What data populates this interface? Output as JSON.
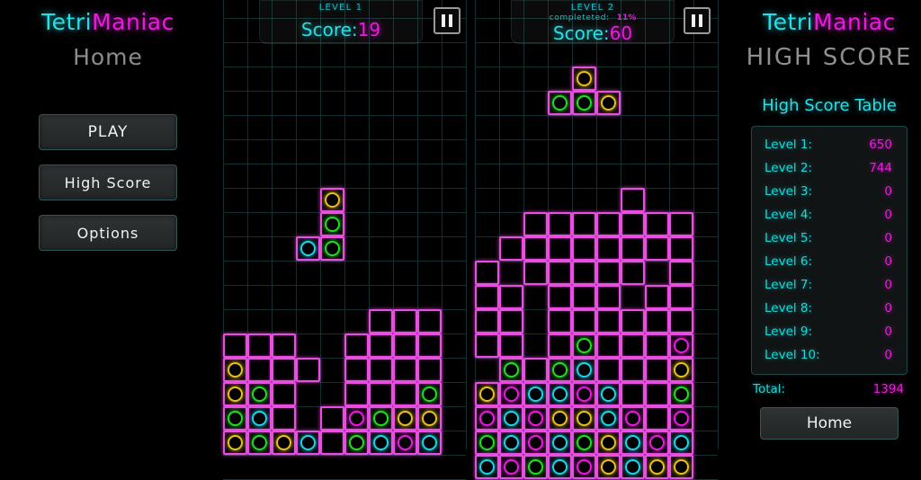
{
  "app": {
    "name_part1": "Tetri",
    "name_part2": "Maniac",
    "accent_cyan": "#24e0e8",
    "accent_magenta": "#ee19e0"
  },
  "left_panel": {
    "subtitle": "Home",
    "buttons": [
      {
        "label": "PLAY",
        "name": "play-button"
      },
      {
        "label": "High Score",
        "name": "high-score-button"
      },
      {
        "label": "Options",
        "name": "options-button"
      }
    ]
  },
  "right_panel": {
    "subtitle": "HIGH SCORE",
    "table_title": "High Score Table",
    "rows": [
      {
        "label": "Level 1:",
        "value": "650"
      },
      {
        "label": "Level 2:",
        "value": "744"
      },
      {
        "label": "Level 3:",
        "value": "0"
      },
      {
        "label": "Level 4:",
        "value": "0"
      },
      {
        "label": "Level 5:",
        "value": "0"
      },
      {
        "label": "Level 6:",
        "value": "0"
      },
      {
        "label": "Level 7:",
        "value": "0"
      },
      {
        "label": "Level 8:",
        "value": "0"
      },
      {
        "label": "Level 9:",
        "value": "0"
      },
      {
        "label": "Level 10:",
        "value": "0"
      }
    ],
    "total_label": "Total:",
    "total_value": "1394",
    "home_label": "Home"
  },
  "boards": [
    {
      "name": "board-left",
      "level_text": "LEVEL 1",
      "completed_label": null,
      "completed_pct": null,
      "score_label": "Score:",
      "score_value": "19",
      "pause_icon": "pause-icon",
      "cols": 10,
      "rows": 19,
      "falling_piece": [
        {
          "r": 8,
          "c": 4,
          "color": "y"
        },
        {
          "r": 9,
          "c": 4,
          "color": "g"
        },
        {
          "r": 10,
          "c": 3,
          "color": "c"
        },
        {
          "r": 10,
          "c": 4,
          "color": "g"
        }
      ],
      "stack": [
        {
          "r": 13,
          "c": 6,
          "color": null
        },
        {
          "r": 13,
          "c": 7,
          "color": null
        },
        {
          "r": 13,
          "c": 8,
          "color": null
        },
        {
          "r": 14,
          "c": 0,
          "color": null
        },
        {
          "r": 14,
          "c": 1,
          "color": null
        },
        {
          "r": 14,
          "c": 2,
          "color": null
        },
        {
          "r": 14,
          "c": 5,
          "color": null
        },
        {
          "r": 14,
          "c": 6,
          "color": null
        },
        {
          "r": 14,
          "c": 7,
          "color": null
        },
        {
          "r": 14,
          "c": 8,
          "color": null
        },
        {
          "r": 15,
          "c": 0,
          "color": "y"
        },
        {
          "r": 15,
          "c": 1,
          "color": null
        },
        {
          "r": 15,
          "c": 2,
          "color": null
        },
        {
          "r": 15,
          "c": 3,
          "color": null
        },
        {
          "r": 15,
          "c": 5,
          "color": null
        },
        {
          "r": 15,
          "c": 6,
          "color": null
        },
        {
          "r": 15,
          "c": 7,
          "color": null
        },
        {
          "r": 15,
          "c": 8,
          "color": null
        },
        {
          "r": 16,
          "c": 0,
          "color": "y"
        },
        {
          "r": 16,
          "c": 1,
          "color": "g"
        },
        {
          "r": 16,
          "c": 2,
          "color": null
        },
        {
          "r": 16,
          "c": 5,
          "color": null
        },
        {
          "r": 16,
          "c": 6,
          "color": null
        },
        {
          "r": 16,
          "c": 7,
          "color": null
        },
        {
          "r": 16,
          "c": 8,
          "color": "g"
        },
        {
          "r": 17,
          "c": 0,
          "color": "g"
        },
        {
          "r": 17,
          "c": 1,
          "color": "c"
        },
        {
          "r": 17,
          "c": 2,
          "color": null
        },
        {
          "r": 17,
          "c": 4,
          "color": null
        },
        {
          "r": 17,
          "c": 5,
          "color": "m"
        },
        {
          "r": 17,
          "c": 6,
          "color": "g"
        },
        {
          "r": 17,
          "c": 7,
          "color": "y"
        },
        {
          "r": 17,
          "c": 8,
          "color": "y"
        },
        {
          "r": 18,
          "c": 0,
          "color": "y"
        },
        {
          "r": 18,
          "c": 1,
          "color": "g"
        },
        {
          "r": 18,
          "c": 2,
          "color": "y"
        },
        {
          "r": 18,
          "c": 3,
          "color": "c"
        },
        {
          "r": 18,
          "c": 4,
          "color": null
        },
        {
          "r": 18,
          "c": 5,
          "color": "g"
        },
        {
          "r": 18,
          "c": 6,
          "color": "c"
        },
        {
          "r": 18,
          "c": 7,
          "color": "m"
        },
        {
          "r": 18,
          "c": 8,
          "color": "c"
        }
      ]
    },
    {
      "name": "board-right",
      "level_text": "LEVEL 2",
      "completed_label": "completeted:",
      "completed_pct": "11%",
      "score_label": "Score:",
      "score_value": "60",
      "pause_icon": "pause-icon",
      "cols": 10,
      "rows": 19,
      "falling_piece": [
        {
          "r": 3,
          "c": 4,
          "color": "y"
        },
        {
          "r": 4,
          "c": 3,
          "color": "g"
        },
        {
          "r": 4,
          "c": 4,
          "color": "g"
        },
        {
          "r": 4,
          "c": 5,
          "color": "y"
        }
      ],
      "stack": [
        {
          "r": 8,
          "c": 6,
          "color": null
        },
        {
          "r": 9,
          "c": 2,
          "color": null
        },
        {
          "r": 9,
          "c": 3,
          "color": null
        },
        {
          "r": 9,
          "c": 4,
          "color": null
        },
        {
          "r": 9,
          "c": 5,
          "color": null
        },
        {
          "r": 9,
          "c": 6,
          "color": null
        },
        {
          "r": 9,
          "c": 7,
          "color": null
        },
        {
          "r": 9,
          "c": 8,
          "color": null
        },
        {
          "r": 10,
          "c": 1,
          "color": null
        },
        {
          "r": 10,
          "c": 2,
          "color": null
        },
        {
          "r": 10,
          "c": 3,
          "color": null
        },
        {
          "r": 10,
          "c": 4,
          "color": null
        },
        {
          "r": 10,
          "c": 5,
          "color": null
        },
        {
          "r": 10,
          "c": 6,
          "color": null
        },
        {
          "r": 10,
          "c": 7,
          "color": null
        },
        {
          "r": 10,
          "c": 8,
          "color": null
        },
        {
          "r": 11,
          "c": 0,
          "color": null
        },
        {
          "r": 11,
          "c": 2,
          "color": null
        },
        {
          "r": 11,
          "c": 3,
          "color": null
        },
        {
          "r": 11,
          "c": 4,
          "color": null
        },
        {
          "r": 11,
          "c": 5,
          "color": null
        },
        {
          "r": 11,
          "c": 6,
          "color": null
        },
        {
          "r": 11,
          "c": 8,
          "color": null
        },
        {
          "r": 12,
          "c": 0,
          "color": null
        },
        {
          "r": 12,
          "c": 1,
          "color": null
        },
        {
          "r": 12,
          "c": 3,
          "color": null
        },
        {
          "r": 12,
          "c": 4,
          "color": null
        },
        {
          "r": 12,
          "c": 5,
          "color": null
        },
        {
          "r": 12,
          "c": 7,
          "color": null
        },
        {
          "r": 12,
          "c": 8,
          "color": null
        },
        {
          "r": 13,
          "c": 0,
          "color": null
        },
        {
          "r": 13,
          "c": 1,
          "color": null
        },
        {
          "r": 13,
          "c": 3,
          "color": null
        },
        {
          "r": 13,
          "c": 4,
          "color": null
        },
        {
          "r": 13,
          "c": 5,
          "color": null
        },
        {
          "r": 13,
          "c": 6,
          "color": null
        },
        {
          "r": 13,
          "c": 7,
          "color": null
        },
        {
          "r": 13,
          "c": 8,
          "color": null
        },
        {
          "r": 14,
          "c": 0,
          "color": null
        },
        {
          "r": 14,
          "c": 1,
          "color": null
        },
        {
          "r": 14,
          "c": 3,
          "color": null
        },
        {
          "r": 14,
          "c": 4,
          "color": "g"
        },
        {
          "r": 14,
          "c": 5,
          "color": null
        },
        {
          "r": 14,
          "c": 6,
          "color": null
        },
        {
          "r": 14,
          "c": 7,
          "color": null
        },
        {
          "r": 14,
          "c": 8,
          "color": "m"
        },
        {
          "r": 15,
          "c": 1,
          "color": "g"
        },
        {
          "r": 15,
          "c": 2,
          "color": null
        },
        {
          "r": 15,
          "c": 3,
          "color": "g"
        },
        {
          "r": 15,
          "c": 4,
          "color": "c"
        },
        {
          "r": 15,
          "c": 5,
          "color": null
        },
        {
          "r": 15,
          "c": 6,
          "color": null
        },
        {
          "r": 15,
          "c": 7,
          "color": null
        },
        {
          "r": 15,
          "c": 8,
          "color": "y"
        },
        {
          "r": 16,
          "c": 0,
          "color": "y"
        },
        {
          "r": 16,
          "c": 1,
          "color": "m"
        },
        {
          "r": 16,
          "c": 2,
          "color": "c"
        },
        {
          "r": 16,
          "c": 3,
          "color": "c"
        },
        {
          "r": 16,
          "c": 4,
          "color": "m"
        },
        {
          "r": 16,
          "c": 5,
          "color": "c"
        },
        {
          "r": 16,
          "c": 6,
          "color": null
        },
        {
          "r": 16,
          "c": 7,
          "color": null
        },
        {
          "r": 16,
          "c": 8,
          "color": "g"
        },
        {
          "r": 17,
          "c": 0,
          "color": "m"
        },
        {
          "r": 17,
          "c": 1,
          "color": "c"
        },
        {
          "r": 17,
          "c": 2,
          "color": "m"
        },
        {
          "r": 17,
          "c": 3,
          "color": "y"
        },
        {
          "r": 17,
          "c": 4,
          "color": "y"
        },
        {
          "r": 17,
          "c": 5,
          "color": "c"
        },
        {
          "r": 17,
          "c": 6,
          "color": "m"
        },
        {
          "r": 17,
          "c": 7,
          "color": null
        },
        {
          "r": 17,
          "c": 8,
          "color": "m"
        },
        {
          "r": 18,
          "c": 0,
          "color": "g"
        },
        {
          "r": 18,
          "c": 1,
          "color": "c"
        },
        {
          "r": 18,
          "c": 2,
          "color": "m"
        },
        {
          "r": 18,
          "c": 3,
          "color": "c"
        },
        {
          "r": 18,
          "c": 4,
          "color": "g"
        },
        {
          "r": 18,
          "c": 5,
          "color": "y"
        },
        {
          "r": 18,
          "c": 6,
          "color": "c"
        },
        {
          "r": 18,
          "c": 7,
          "color": "m"
        },
        {
          "r": 18,
          "c": 8,
          "color": "c"
        }
      ],
      "bottom_row": [
        {
          "r": 19,
          "c": 0,
          "color": "c"
        },
        {
          "r": 19,
          "c": 1,
          "color": "m"
        },
        {
          "r": 19,
          "c": 2,
          "color": "g"
        },
        {
          "r": 19,
          "c": 3,
          "color": "c"
        },
        {
          "r": 19,
          "c": 4,
          "color": "m"
        },
        {
          "r": 19,
          "c": 5,
          "color": "y"
        },
        {
          "r": 19,
          "c": 6,
          "color": "c"
        },
        {
          "r": 19,
          "c": 7,
          "color": "y"
        },
        {
          "r": 19,
          "c": 8,
          "color": "y"
        }
      ]
    }
  ]
}
